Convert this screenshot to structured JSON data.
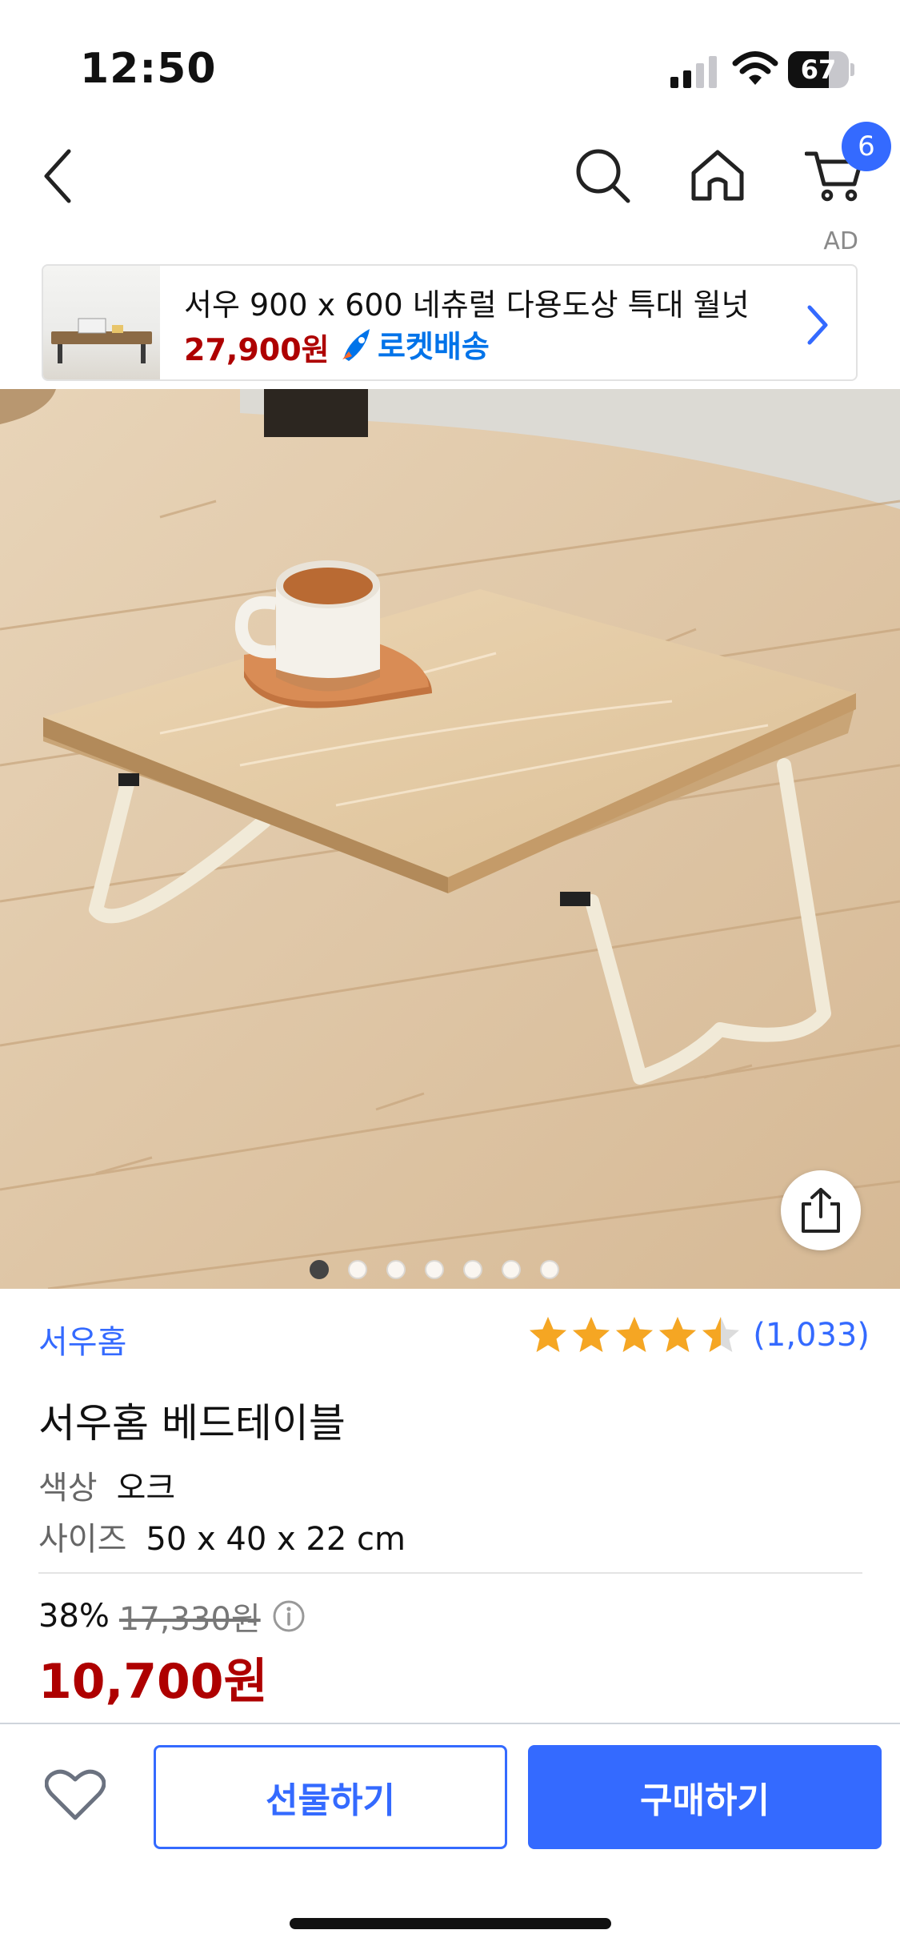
{
  "status_bar": {
    "time": "12:50",
    "battery": "67",
    "battery_level": 0.67
  },
  "nav": {
    "cart_count": "6",
    "icons": [
      "back-icon",
      "search-icon",
      "home-icon",
      "cart-icon"
    ]
  },
  "ad": {
    "label": "AD",
    "title": "서우 900 x 600 네츄럴 다용도상 특대 월넛",
    "price": "27,900원",
    "delivery": "로켓배송",
    "delivery_color": "#0073e9"
  },
  "gallery": {
    "image_count": 7,
    "active_index": 0
  },
  "product": {
    "brand": "서우홈",
    "rating": 4.5,
    "review_count": "(1,033)",
    "title": "서우홈 베드테이블",
    "options": [
      {
        "key": "색상",
        "value": "오크"
      },
      {
        "key": "사이즈",
        "value": "50 x 40 x 22 cm"
      }
    ],
    "discount_rate": "38%",
    "original_price": "17,330원",
    "sale_price": "10,700원"
  },
  "actions": {
    "gift_label": "선물하기",
    "buy_label": "구매하기"
  },
  "colors": {
    "accent": "#346aff",
    "price_red": "#ae0000",
    "star": "#f5a623"
  }
}
